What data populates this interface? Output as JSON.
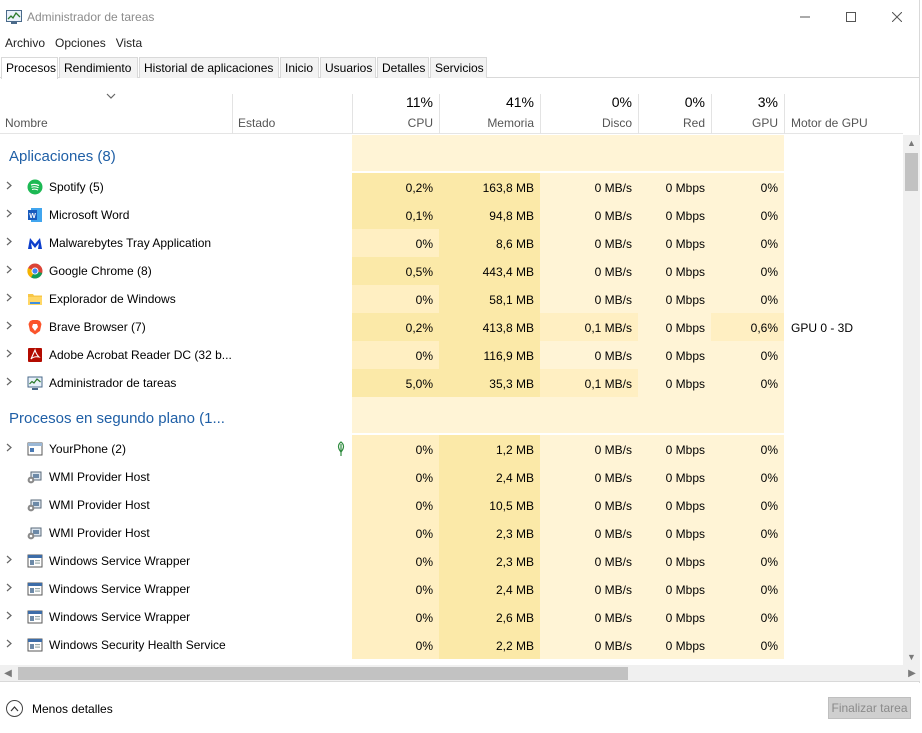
{
  "window": {
    "title": "Administrador de tareas"
  },
  "menu": [
    "Archivo",
    "Opciones",
    "Vista"
  ],
  "tabs": [
    {
      "label": "Procesos",
      "active": true
    },
    {
      "label": "Rendimiento"
    },
    {
      "label": "Historial de aplicaciones"
    },
    {
      "label": "Inicio"
    },
    {
      "label": "Usuarios"
    },
    {
      "label": "Detalles"
    },
    {
      "label": "Servicios"
    }
  ],
  "columns": {
    "name": "Nombre",
    "status": "Estado",
    "cpu": {
      "pct": "11%",
      "label": "CPU"
    },
    "memory": {
      "pct": "41%",
      "label": "Memoria"
    },
    "disk": {
      "pct": "0%",
      "label": "Disco"
    },
    "network": {
      "pct": "0%",
      "label": "Red"
    },
    "gpu": {
      "pct": "3%",
      "label": "GPU"
    },
    "gpu_engine": "Motor de GPU"
  },
  "groups": {
    "apps": "Aplicaciones (8)",
    "background": "Procesos en segundo plano (1..."
  },
  "processes": [
    {
      "name": "Spotify (5)",
      "icon": "spotify-icon",
      "expandable": true,
      "cpu": "0,2%",
      "mem": "163,8 MB",
      "disk": "0 MB/s",
      "net": "0 Mbps",
      "gpu": "0%",
      "engine": ""
    },
    {
      "name": "Microsoft Word",
      "icon": "word-icon",
      "expandable": true,
      "cpu": "0,1%",
      "mem": "94,8 MB",
      "disk": "0 MB/s",
      "net": "0 Mbps",
      "gpu": "0%",
      "engine": ""
    },
    {
      "name": "Malwarebytes Tray Application",
      "icon": "malwarebytes-icon",
      "expandable": true,
      "cpu": "0%",
      "mem": "8,6 MB",
      "disk": "0 MB/s",
      "net": "0 Mbps",
      "gpu": "0%",
      "engine": ""
    },
    {
      "name": "Google Chrome (8)",
      "icon": "chrome-icon",
      "expandable": true,
      "cpu": "0,5%",
      "mem": "443,4 MB",
      "disk": "0 MB/s",
      "net": "0 Mbps",
      "gpu": "0%",
      "engine": ""
    },
    {
      "name": "Explorador de Windows",
      "icon": "folder-icon",
      "expandable": true,
      "cpu": "0%",
      "mem": "58,1 MB",
      "disk": "0 MB/s",
      "net": "0 Mbps",
      "gpu": "0%",
      "engine": ""
    },
    {
      "name": "Brave Browser (7)",
      "icon": "brave-icon",
      "expandable": true,
      "cpu": "0,2%",
      "mem": "413,8 MB",
      "disk": "0,1 MB/s",
      "net": "0 Mbps",
      "gpu": "0,6%",
      "engine": "GPU 0 - 3D"
    },
    {
      "name": "Adobe Acrobat Reader DC (32 b...",
      "icon": "acrobat-icon",
      "expandable": true,
      "cpu": "0%",
      "mem": "116,9 MB",
      "disk": "0 MB/s",
      "net": "0 Mbps",
      "gpu": "0%",
      "engine": ""
    },
    {
      "name": "Administrador de tareas",
      "icon": "taskmgr-icon",
      "expandable": true,
      "cpu": "5,0%",
      "mem": "35,3 MB",
      "disk": "0,1 MB/s",
      "net": "0 Mbps",
      "gpu": "0%",
      "engine": ""
    },
    {
      "name": "YourPhone (2)",
      "icon": "yourphone-icon",
      "expandable": true,
      "status_icon": "leaf-icon",
      "cpu": "0%",
      "mem": "1,2 MB",
      "disk": "0 MB/s",
      "net": "0 Mbps",
      "gpu": "0%",
      "engine": ""
    },
    {
      "name": "WMI Provider Host",
      "icon": "wmi-icon",
      "expandable": false,
      "cpu": "0%",
      "mem": "2,4 MB",
      "disk": "0 MB/s",
      "net": "0 Mbps",
      "gpu": "0%",
      "engine": ""
    },
    {
      "name": "WMI Provider Host",
      "icon": "wmi-icon",
      "expandable": false,
      "cpu": "0%",
      "mem": "10,5 MB",
      "disk": "0 MB/s",
      "net": "0 Mbps",
      "gpu": "0%",
      "engine": ""
    },
    {
      "name": "WMI Provider Host",
      "icon": "wmi-icon",
      "expandable": false,
      "cpu": "0%",
      "mem": "2,3 MB",
      "disk": "0 MB/s",
      "net": "0 Mbps",
      "gpu": "0%",
      "engine": ""
    },
    {
      "name": "Windows Service Wrapper",
      "icon": "service-icon",
      "expandable": true,
      "cpu": "0%",
      "mem": "2,3 MB",
      "disk": "0 MB/s",
      "net": "0 Mbps",
      "gpu": "0%",
      "engine": ""
    },
    {
      "name": "Windows Service Wrapper",
      "icon": "service-icon",
      "expandable": true,
      "cpu": "0%",
      "mem": "2,4 MB",
      "disk": "0 MB/s",
      "net": "0 Mbps",
      "gpu": "0%",
      "engine": ""
    },
    {
      "name": "Windows Service Wrapper",
      "icon": "service-icon",
      "expandable": true,
      "cpu": "0%",
      "mem": "2,6 MB",
      "disk": "0 MB/s",
      "net": "0 Mbps",
      "gpu": "0%",
      "engine": ""
    },
    {
      "name": "Windows Security Health Service",
      "icon": "service-icon",
      "expandable": true,
      "cpu": "0%",
      "mem": "2,2 MB",
      "disk": "0 MB/s",
      "net": "0 Mbps",
      "gpu": "0%",
      "engine": ""
    }
  ],
  "footer": {
    "less_details": "Menos detalles",
    "end_task": "Finalizar tarea"
  },
  "colors": {
    "heat_light": "#fff4d6",
    "heat_medium": "#ffefc2",
    "heat_strong": "#fbe9a8",
    "group_blue": "#1f5fa6"
  }
}
